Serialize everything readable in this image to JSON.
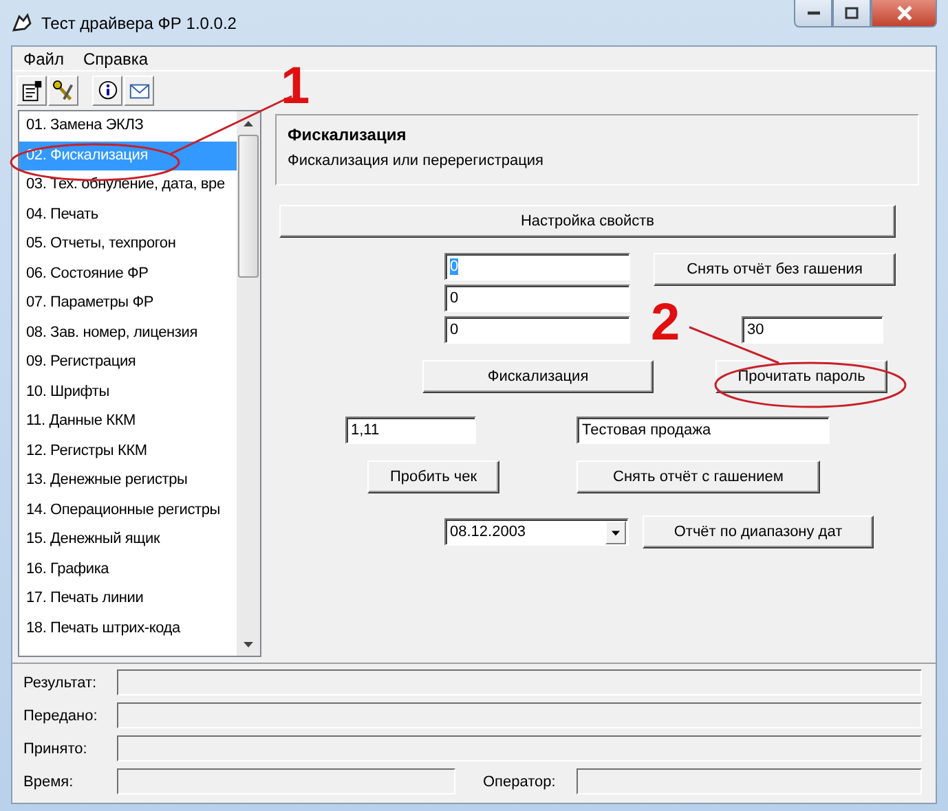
{
  "window": {
    "title": "Тест драйвера ФР 1.0.0.2"
  },
  "menu": [
    "Файл",
    "Справка"
  ],
  "sidebar": {
    "items": [
      {
        "label": "01. Замена ЭКЛЗ",
        "selected": false
      },
      {
        "label": "02. Фискализация",
        "selected": true
      },
      {
        "label": "03. Тех. обнуление, дата, вре",
        "selected": false
      },
      {
        "label": "04. Печать",
        "selected": false
      },
      {
        "label": "05. Отчеты, техпрогон",
        "selected": false
      },
      {
        "label": "06. Состояние ФР",
        "selected": false
      },
      {
        "label": "07. Параметры ФР",
        "selected": false
      },
      {
        "label": "08. Зав. номер, лицензия",
        "selected": false
      },
      {
        "label": "09. Регистрация",
        "selected": false
      },
      {
        "label": "10. Шрифты",
        "selected": false
      },
      {
        "label": "11. Данные ККМ",
        "selected": false
      },
      {
        "label": "12. Регистры ККМ",
        "selected": false
      },
      {
        "label": "13. Денежные регистры",
        "selected": false
      },
      {
        "label": "14. Операционные регистры",
        "selected": false
      },
      {
        "label": "15. Денежный ящик",
        "selected": false
      },
      {
        "label": "16. Графика",
        "selected": false
      },
      {
        "label": "17. Печать линии",
        "selected": false
      },
      {
        "label": "18. Печать штрих-кода",
        "selected": false
      }
    ]
  },
  "panel": {
    "title": "Фискализация",
    "subtitle": "Фискализация или перерегистрация"
  },
  "form": {
    "properties_button": "Настройка свойств",
    "fields": [
      "0",
      "0",
      "0"
    ],
    "report_no_clear_button": "Снять отчёт без гашения",
    "password_field": "30",
    "fiscalize_button": "Фискализация",
    "read_password_button": "Прочитать пароль",
    "amount_field": "1,11",
    "text_field": "Тестовая продажа",
    "print_check_button": "Пробить чек",
    "report_clear_button": "Снять отчёт с гашением",
    "date_field": "08.12.2003",
    "date_report_button": "Отчёт по диапазону дат"
  },
  "status": {
    "rows": [
      "Результат:",
      "Передано:",
      "Принято:"
    ],
    "time_label": "Время:",
    "operator_label": "Оператор:"
  },
  "annotations": [
    "1",
    "2"
  ]
}
